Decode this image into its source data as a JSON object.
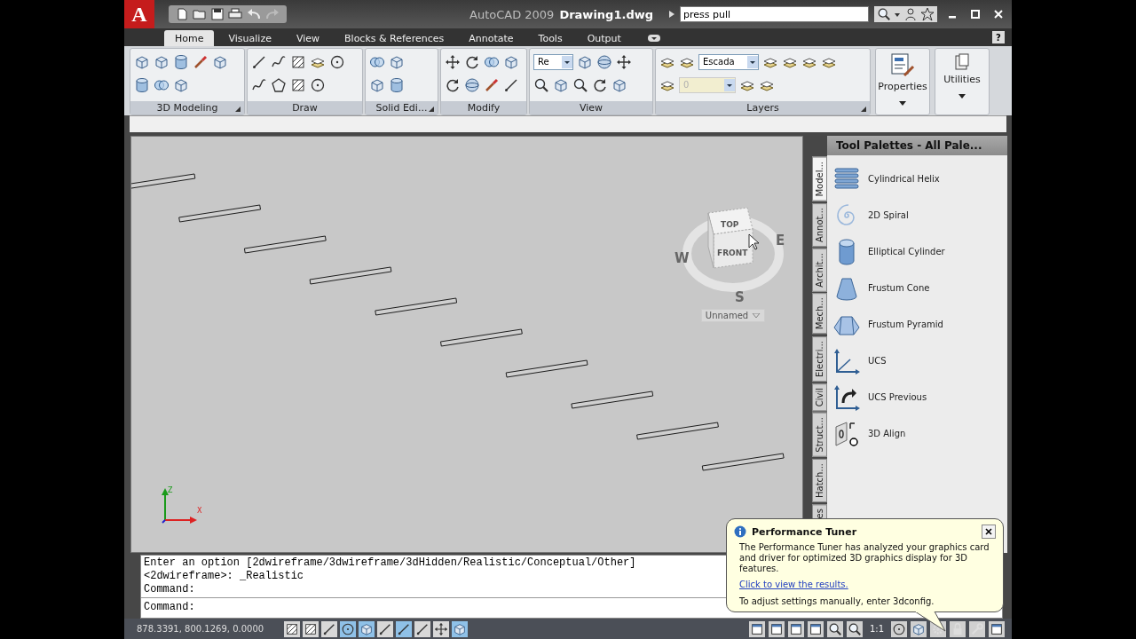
{
  "app_button_label": "A",
  "window": {
    "app_name": "AutoCAD 2009",
    "document": "Drawing1.dwg"
  },
  "search": {
    "value": "press pull"
  },
  "tabs": [
    {
      "label": "Home",
      "selected": true
    },
    {
      "label": "Visualize",
      "selected": false
    },
    {
      "label": "View",
      "selected": false
    },
    {
      "label": "Blocks & References",
      "selected": false
    },
    {
      "label": "Annotate",
      "selected": false
    },
    {
      "label": "Tools",
      "selected": false
    },
    {
      "label": "Output",
      "selected": false
    }
  ],
  "help_label": "?",
  "ribbon_panels": [
    {
      "title": "3D Modeling",
      "kind": "tools",
      "launcher": true
    },
    {
      "title": "Draw",
      "kind": "tools",
      "launcher": false
    },
    {
      "title": "Solid Edi...",
      "kind": "tools",
      "launcher": true
    },
    {
      "title": "Modify",
      "kind": "tools",
      "launcher": false
    },
    {
      "title": "View",
      "kind": "tools",
      "launcher": false,
      "combos": [
        {
          "value": "Re",
          "disabled": false
        }
      ]
    },
    {
      "title": "Layers",
      "kind": "tools",
      "launcher": true,
      "combos": [
        {
          "value": "Escada",
          "disabled": false
        },
        {
          "value": "0",
          "disabled": true
        }
      ]
    },
    {
      "title": "Properties",
      "kind": "large"
    },
    {
      "title": "Utilities",
      "kind": "large"
    }
  ],
  "viewport": {
    "viewcube": {
      "top": "TOP",
      "front": "FRONT",
      "west": "W",
      "east": "E",
      "south": "S"
    },
    "view_menu": "Unnamed",
    "ucs": {
      "top_label": "Z",
      "x_label": "X"
    }
  },
  "tool_palette": {
    "title": "Tool Palettes - All Pale...",
    "tabs": [
      {
        "label": "Model...",
        "selected": true
      },
      {
        "label": "Annot...",
        "selected": false
      },
      {
        "label": "Archit...",
        "selected": false
      },
      {
        "label": "Mech...",
        "selected": false
      },
      {
        "label": "Electri...",
        "selected": false
      },
      {
        "label": "Civil",
        "selected": false
      },
      {
        "label": "Struct...",
        "selected": false
      },
      {
        "label": "Hatch...",
        "selected": false
      },
      {
        "label": "es",
        "selected": false
      }
    ],
    "items": [
      {
        "label": "Cylindrical Helix"
      },
      {
        "label": "2D Spiral"
      },
      {
        "label": "Elliptical Cylinder"
      },
      {
        "label": "Frustum Cone"
      },
      {
        "label": "Frustum Pyramid"
      },
      {
        "label": "UCS"
      },
      {
        "label": "UCS Previous"
      },
      {
        "label": "3D Align"
      }
    ]
  },
  "command_line": {
    "history": [
      "Enter an option [2dwireframe/3dwireframe/3dHidden/Realistic/Conceptual/Other]",
      "<2dwireframe>: _Realistic",
      "Command:"
    ],
    "prompt": "Command:"
  },
  "status_bar": {
    "coordinates": "878.3391, 800.1269, 0.0000",
    "toggles": [
      {
        "on": false
      },
      {
        "on": false
      },
      {
        "on": false
      },
      {
        "on": true
      },
      {
        "on": true
      },
      {
        "on": false
      },
      {
        "on": true
      },
      {
        "on": false
      },
      {
        "on": false
      },
      {
        "on": true
      }
    ],
    "annotation_scale": "1:1"
  },
  "notification": {
    "title": "Performance Tuner",
    "message": "The Performance Tuner has analyzed your graphics card and driver for optimized 3D graphics display for 3D features.",
    "link": "Click to view the results.",
    "hint": "To adjust settings manually, enter 3dconfig."
  }
}
